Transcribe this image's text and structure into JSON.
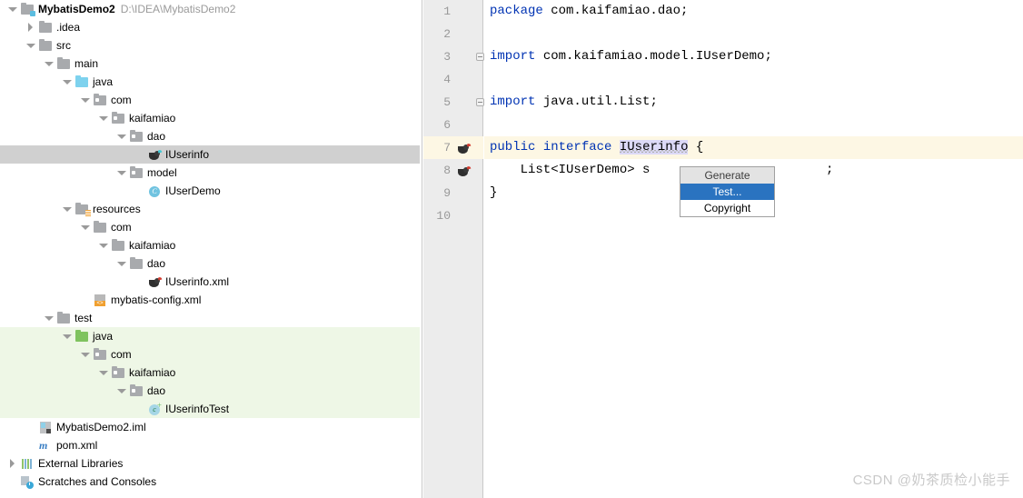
{
  "project_tree": {
    "rows": [
      {
        "label": "MybatisDemo2",
        "path": "D:\\IDEA\\MybatisDemo2",
        "indent": 0,
        "twisty": "down",
        "icon": "module-icon",
        "bold": true,
        "state": "normal"
      },
      {
        "label": ".idea",
        "indent": 1,
        "twisty": "right",
        "icon": "folder-icon",
        "state": "normal"
      },
      {
        "label": "src",
        "indent": 1,
        "twisty": "down",
        "icon": "folder-icon",
        "state": "normal"
      },
      {
        "label": "main",
        "indent": 2,
        "twisty": "down",
        "icon": "folder-icon",
        "state": "normal"
      },
      {
        "label": "java",
        "indent": 3,
        "twisty": "down",
        "icon": "source-root-folder-icon",
        "state": "normal"
      },
      {
        "label": "com",
        "indent": 4,
        "twisty": "down",
        "icon": "package-folder-icon",
        "state": "normal"
      },
      {
        "label": "kaifamiao",
        "indent": 5,
        "twisty": "down",
        "icon": "package-folder-icon",
        "state": "normal"
      },
      {
        "label": "dao",
        "indent": 6,
        "twisty": "down",
        "icon": "package-folder-icon",
        "state": "normal"
      },
      {
        "label": "IUserinfo",
        "indent": 7,
        "twisty": "none",
        "icon": "mybatis-mapper-icon",
        "state": "selected"
      },
      {
        "label": "model",
        "indent": 6,
        "twisty": "down",
        "icon": "package-folder-icon",
        "state": "normal"
      },
      {
        "label": "IUserDemo",
        "indent": 7,
        "twisty": "none",
        "icon": "java-class-icon",
        "state": "normal"
      },
      {
        "label": "resources",
        "indent": 3,
        "twisty": "down",
        "icon": "resources-root-folder-icon",
        "state": "normal"
      },
      {
        "label": "com",
        "indent": 4,
        "twisty": "down",
        "icon": "folder-icon",
        "state": "normal"
      },
      {
        "label": "kaifamiao",
        "indent": 5,
        "twisty": "down",
        "icon": "folder-icon",
        "state": "normal"
      },
      {
        "label": "dao",
        "indent": 6,
        "twisty": "down",
        "icon": "folder-icon",
        "state": "normal"
      },
      {
        "label": "IUserinfo.xml",
        "indent": 7,
        "twisty": "none",
        "icon": "mybatis-mapper-xml-icon",
        "state": "normal"
      },
      {
        "label": "mybatis-config.xml",
        "indent": 4,
        "twisty": "none",
        "icon": "xml-config-icon",
        "state": "normal"
      },
      {
        "label": "test",
        "indent": 2,
        "twisty": "down",
        "icon": "folder-icon",
        "state": "normal"
      },
      {
        "label": "java",
        "indent": 3,
        "twisty": "down",
        "icon": "test-source-root-folder-icon",
        "state": "test-scope"
      },
      {
        "label": "com",
        "indent": 4,
        "twisty": "down",
        "icon": "package-folder-icon",
        "state": "test-scope"
      },
      {
        "label": "kaifamiao",
        "indent": 5,
        "twisty": "down",
        "icon": "package-folder-icon",
        "state": "test-scope"
      },
      {
        "label": "dao",
        "indent": 6,
        "twisty": "down",
        "icon": "package-folder-icon",
        "state": "test-scope"
      },
      {
        "label": "IUserinfoTest",
        "indent": 7,
        "twisty": "none",
        "icon": "java-test-class-icon",
        "state": "test-scope"
      },
      {
        "label": "MybatisDemo2.iml",
        "indent": 1,
        "twisty": "none",
        "icon": "iml-module-file-icon",
        "state": "normal"
      },
      {
        "label": "pom.xml",
        "indent": 1,
        "twisty": "none",
        "icon": "maven-pom-icon",
        "state": "normal"
      },
      {
        "label": "External Libraries",
        "indent": 0,
        "twisty": "right",
        "icon": "external-libraries-icon",
        "state": "normal"
      },
      {
        "label": "Scratches and Consoles",
        "indent": 0,
        "twisty": "none",
        "icon": "scratches-icon",
        "state": "normal"
      }
    ]
  },
  "editor": {
    "lines": [
      {
        "number": "1",
        "gutter_icon": "",
        "current": false,
        "segments": [
          {
            "text": "package",
            "kind": "keyword"
          },
          {
            "text": " com.kaifamiao.dao;",
            "kind": "plain"
          }
        ]
      },
      {
        "number": "2",
        "gutter_icon": "",
        "current": false,
        "segments": []
      },
      {
        "number": "3",
        "gutter_icon": "",
        "current": false,
        "fold": true,
        "segments": [
          {
            "text": "import",
            "kind": "keyword"
          },
          {
            "text": " com.kaifamiao.model.IUserDemo;",
            "kind": "plain"
          }
        ]
      },
      {
        "number": "4",
        "gutter_icon": "",
        "current": false,
        "segments": []
      },
      {
        "number": "5",
        "gutter_icon": "",
        "current": false,
        "fold": true,
        "segments": [
          {
            "text": "import",
            "kind": "keyword"
          },
          {
            "text": " java.util.List;",
            "kind": "plain"
          }
        ]
      },
      {
        "number": "6",
        "gutter_icon": "",
        "current": false,
        "segments": []
      },
      {
        "number": "7",
        "gutter_icon": "mybatis-mapper-gutter-icon",
        "current": true,
        "segments": [
          {
            "text": "public",
            "kind": "keyword"
          },
          {
            "text": " ",
            "kind": "plain"
          },
          {
            "text": "interface",
            "kind": "keyword"
          },
          {
            "text": " ",
            "kind": "plain"
          },
          {
            "text": "IUserinfo",
            "kind": "identifier-selected"
          },
          {
            "text": " {",
            "kind": "plain"
          }
        ]
      },
      {
        "number": "8",
        "gutter_icon": "mybatis-statement-gutter-icon",
        "current": false,
        "segments": [
          {
            "text": "    List<IUserDemo> s",
            "kind": "plain"
          }
        ]
      },
      {
        "number": "9",
        "gutter_icon": "",
        "current": false,
        "segments": [
          {
            "text": "}",
            "kind": "plain"
          }
        ]
      },
      {
        "number": "10",
        "gutter_icon": "",
        "current": false,
        "segments": []
      }
    ],
    "line8_tail": ";"
  },
  "popup_menu": {
    "items": [
      {
        "label": "Generate",
        "state": "header"
      },
      {
        "label": "Test...",
        "state": "active"
      },
      {
        "label": "Copyright",
        "state": "normal"
      }
    ]
  },
  "watermark": {
    "text": "CSDN @奶茶质检小能手"
  },
  "colors": {
    "selection_gray": "#d0d0d0",
    "test_scope_green": "#eef7e6",
    "caret_line": "#fdf7e4",
    "keyword_blue": "#0033b3",
    "menu_active_blue": "#2a73c0",
    "menu_header_gray": "#e3e3e3",
    "identifier_selection": "#dcd9f7"
  }
}
